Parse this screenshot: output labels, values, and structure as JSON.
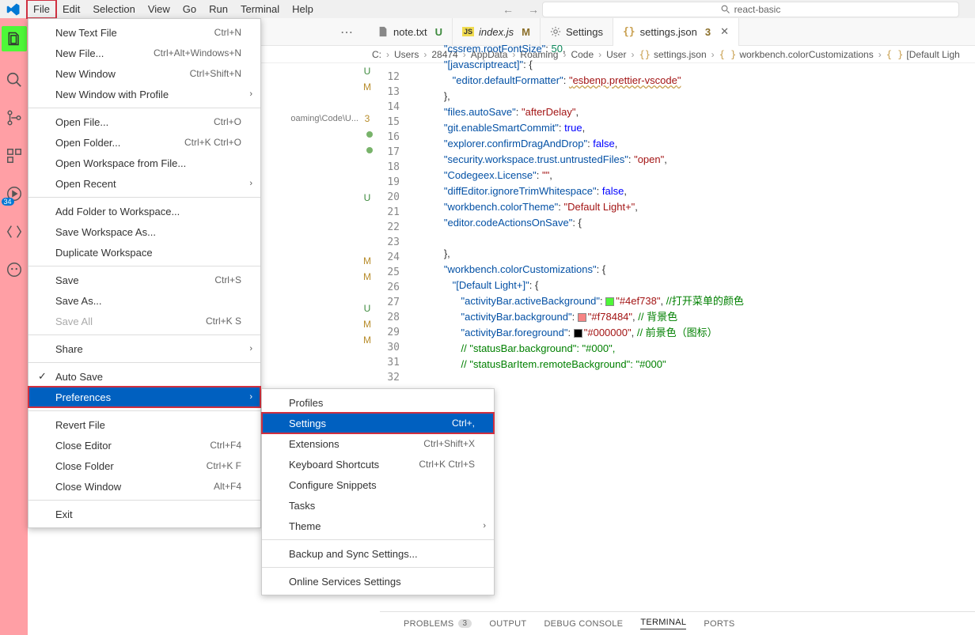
{
  "titlebar": {
    "project": "react-basic"
  },
  "menubar": [
    "File",
    "Edit",
    "Selection",
    "View",
    "Go",
    "Run",
    "Terminal",
    "Help"
  ],
  "activity": {
    "badge": "34"
  },
  "tabs": [
    {
      "icon": "file",
      "label": "note.txt",
      "status": "U"
    },
    {
      "icon": "js",
      "label": "index.js",
      "status": "M"
    },
    {
      "icon": "gear",
      "label": "Settings",
      "status": ""
    },
    {
      "icon": "braces",
      "label": "settings.json",
      "status": "3",
      "active": true,
      "close": true
    }
  ],
  "breadcrumbs": [
    "C:",
    "Users",
    "28474",
    "AppData",
    "Roaming",
    "Code",
    "User",
    "settings.json",
    "workbench.colorCustomizations",
    "[Default Ligh"
  ],
  "open_editors_visible": [
    {
      "txt": "",
      "st": "U"
    },
    {
      "txt": "",
      "st": "M"
    },
    {
      "txt": "",
      "st": ""
    },
    {
      "txt": "oaming\\Code\\U...",
      "st": "3"
    },
    {
      "txt": "",
      "dot": true
    },
    {
      "txt": "",
      "dot": true
    },
    {
      "txt": "",
      "st": ""
    },
    {
      "txt": "",
      "st": ""
    },
    {
      "txt": "",
      "st": "U"
    },
    {
      "txt": "",
      "st": ""
    },
    {
      "txt": "",
      "st": ""
    },
    {
      "txt": "",
      "st": ""
    },
    {
      "txt": "",
      "st": "M"
    },
    {
      "txt": "",
      "st": "M"
    },
    {
      "txt": "",
      "st": ""
    },
    {
      "txt": "",
      "st": "U"
    },
    {
      "txt": "",
      "st": "M"
    },
    {
      "txt": "",
      "st": "M"
    }
  ],
  "lines": {
    "start": 12,
    "end": 32
  },
  "code": {
    "l12": {
      "key": "cssrem.rootFontSize",
      "val": "50"
    },
    "l13": {
      "key": "[javascriptreact]"
    },
    "l14": {
      "key": "editor.defaultFormatter",
      "val": "esbenp.prettier-vscode"
    },
    "l16": {
      "key": "files.autoSave",
      "val": "afterDelay"
    },
    "l17": {
      "key": "git.enableSmartCommit",
      "val": "true"
    },
    "l18": {
      "key": "explorer.confirmDragAndDrop",
      "val": "false"
    },
    "l19": {
      "key": "security.workspace.trust.untrustedFiles",
      "val": "open"
    },
    "l20": {
      "key": "Codegeex.License",
      "val": ""
    },
    "l21": {
      "key": "diffEditor.ignoreTrimWhitespace",
      "val": "false"
    },
    "l22": {
      "key": "workbench.colorTheme",
      "val": "Default Light+"
    },
    "l23": {
      "key": "editor.codeActionsOnSave"
    },
    "l26": {
      "key": "workbench.colorCustomizations"
    },
    "l27": {
      "key": "[Default Light+]"
    },
    "l28": {
      "key": "activityBar.activeBackground",
      "val": "#4ef738",
      "comment": "//打开菜单的颜色"
    },
    "l29": {
      "key": "activityBar.background",
      "val": "#f78484",
      "comment": "// 背景色"
    },
    "l30": {
      "key": "activityBar.foreground",
      "val": "#000000",
      "comment": "// 前景色（图标）"
    },
    "l31": {
      "comment": "// \"statusBar.background\": \"#000\","
    },
    "l32": {
      "comment": "// \"statusBarItem.remoteBackground\": \"#000\""
    }
  },
  "file_menu": [
    {
      "label": "New Text File",
      "shortcut": "Ctrl+N"
    },
    {
      "label": "New File...",
      "shortcut": "Ctrl+Alt+Windows+N"
    },
    {
      "label": "New Window",
      "shortcut": "Ctrl+Shift+N"
    },
    {
      "label": "New Window with Profile",
      "submenu": true
    },
    {
      "sep": true
    },
    {
      "label": "Open File...",
      "shortcut": "Ctrl+O"
    },
    {
      "label": "Open Folder...",
      "shortcut": "Ctrl+K Ctrl+O"
    },
    {
      "label": "Open Workspace from File..."
    },
    {
      "label": "Open Recent",
      "submenu": true
    },
    {
      "sep": true
    },
    {
      "label": "Add Folder to Workspace..."
    },
    {
      "label": "Save Workspace As..."
    },
    {
      "label": "Duplicate Workspace"
    },
    {
      "sep": true
    },
    {
      "label": "Save",
      "shortcut": "Ctrl+S"
    },
    {
      "label": "Save As..."
    },
    {
      "label": "Save All",
      "shortcut": "Ctrl+K S",
      "disabled": true
    },
    {
      "sep": true
    },
    {
      "label": "Share",
      "submenu": true
    },
    {
      "sep": true
    },
    {
      "label": "Auto Save",
      "check": true
    },
    {
      "label": "Preferences",
      "submenu": true,
      "selected": true,
      "redbox": true
    },
    {
      "sep": true
    },
    {
      "label": "Revert File"
    },
    {
      "label": "Close Editor",
      "shortcut": "Ctrl+F4"
    },
    {
      "label": "Close Folder",
      "shortcut": "Ctrl+K F"
    },
    {
      "label": "Close Window",
      "shortcut": "Alt+F4"
    },
    {
      "sep": true
    },
    {
      "label": "Exit"
    }
  ],
  "prefs_menu": [
    {
      "label": "Profiles"
    },
    {
      "label": "Settings",
      "shortcut": "Ctrl+,",
      "selected": true,
      "redbox": true
    },
    {
      "label": "Extensions",
      "shortcut": "Ctrl+Shift+X"
    },
    {
      "label": "Keyboard Shortcuts",
      "shortcut": "Ctrl+K Ctrl+S"
    },
    {
      "label": "Configure Snippets"
    },
    {
      "label": "Tasks"
    },
    {
      "label": "Theme",
      "submenu": true
    },
    {
      "sep": true
    },
    {
      "label": "Backup and Sync Settings..."
    },
    {
      "sep": true
    },
    {
      "label": "Online Services Settings"
    }
  ],
  "panel": {
    "tabs": [
      "PROBLEMS",
      "OUTPUT",
      "DEBUG CONSOLE",
      "TERMINAL",
      "PORTS"
    ],
    "problems_badge": "3",
    "active": "TERMINAL"
  }
}
